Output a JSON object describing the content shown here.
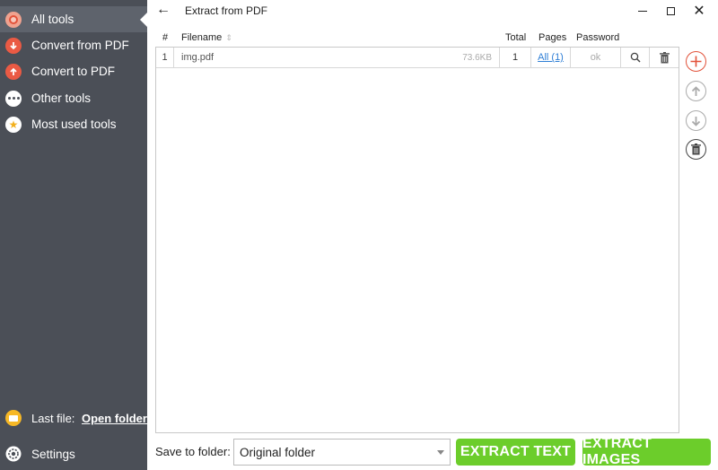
{
  "sidebar": {
    "items": [
      {
        "label": "All tools",
        "icon": "all-tools-icon"
      },
      {
        "label": "Convert from PDF",
        "icon": "convert-from-pdf-icon"
      },
      {
        "label": "Convert to PDF",
        "icon": "convert-to-pdf-icon"
      },
      {
        "label": "Other tools",
        "icon": "other-tools-icon"
      },
      {
        "label": "Most used tools",
        "icon": "star-icon"
      }
    ],
    "last_file_label": "Last file:",
    "open_folder": "Open folder",
    "settings": "Settings"
  },
  "titlebar": {
    "title": "Extract from PDF",
    "back": "←",
    "minimize": "",
    "maximize": "",
    "close": "✕"
  },
  "table": {
    "headers": {
      "num": "#",
      "filename": "Filename",
      "total": "Total",
      "pages": "Pages",
      "password": "Password"
    },
    "rows": [
      {
        "num": "1",
        "filename": "img.pdf",
        "size": "73.6KB",
        "total": "1",
        "pages": "All (1)",
        "password": "ok"
      }
    ]
  },
  "bottom": {
    "save_label": "Save to folder:",
    "folder_value": "Original folder",
    "extract_text": "EXTRACT TEXT",
    "extract_images": "EXTRACT IMAGES"
  },
  "colors": {
    "sidebar_bg": "#4b4f57",
    "accent_red": "#e2523a",
    "button_green": "#6ccd2b",
    "link_blue": "#2f7fd6"
  }
}
